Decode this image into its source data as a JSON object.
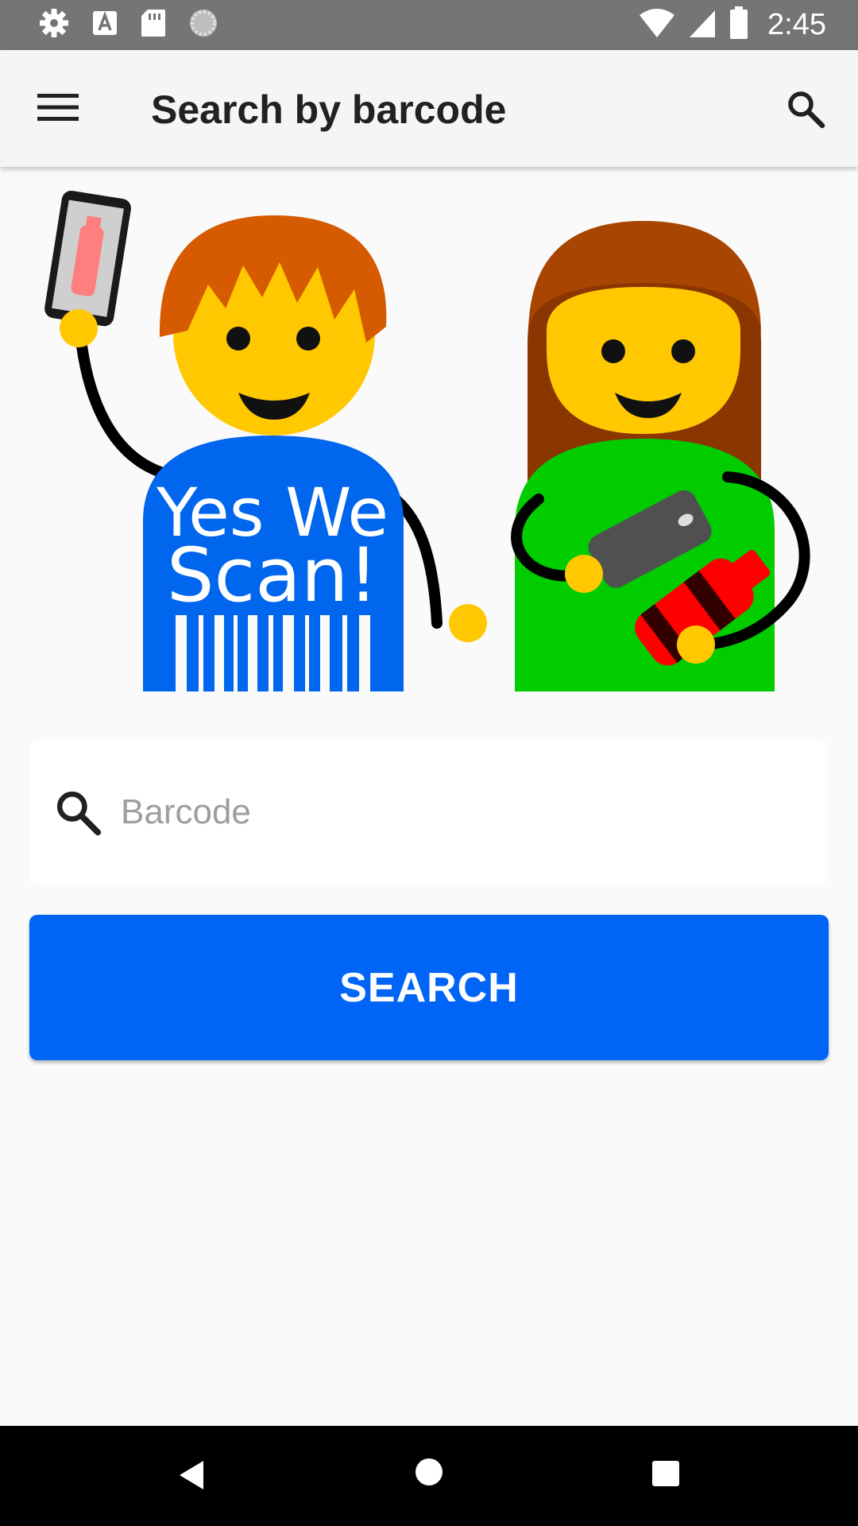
{
  "status_bar": {
    "time": "2:45",
    "left_icons": [
      "gear-icon",
      "text-a-icon",
      "sd-card-icon",
      "sync-icon"
    ],
    "right_icons": [
      "wifi-icon",
      "cell-signal-icon",
      "battery-icon"
    ]
  },
  "app_bar": {
    "title": "Search by barcode",
    "menu_icon": "menu-icon",
    "search_icon": "search-icon"
  },
  "illustration": {
    "text_line1": "Yes We",
    "text_line2": "Scan!"
  },
  "barcode_field": {
    "icon": "search-icon",
    "placeholder": "Barcode",
    "value": ""
  },
  "search_button": {
    "label": "SEARCH"
  },
  "nav_bar": {
    "icons": [
      "back-icon",
      "home-icon",
      "recents-icon"
    ]
  },
  "colors": {
    "status_bar": "#757575",
    "app_bar": "#f5f5f5",
    "background": "#fafafa",
    "accent": "#0064f6",
    "nav_bar": "#000000"
  }
}
